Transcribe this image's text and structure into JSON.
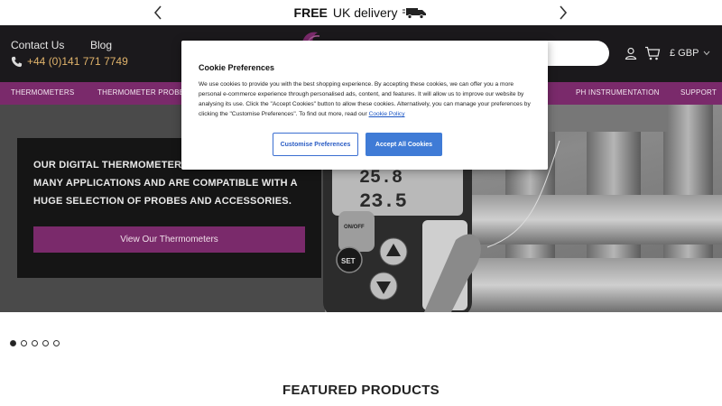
{
  "promo": {
    "bold": "FREE",
    "text": "UK delivery",
    "icon": "truck-icon"
  },
  "header": {
    "contact_label": "Contact Us",
    "blog_label": "Blog",
    "phone": "+44 (0)141 771 7749",
    "currency": "£ GBP",
    "colors": {
      "bg": "#1b191c",
      "accent": "#e0b36b"
    }
  },
  "nav": {
    "items": [
      "THERMOMETERS",
      "THERMOMETER PROBE",
      "PH INSTRUMENTATION",
      "SUPPORT"
    ],
    "color": "#7a2a6b"
  },
  "hero": {
    "headline": "OUR DIGITAL THERMOMETERS ARE SUITABLE FOR MANY APPLICATIONS AND ARE COMPATIBLE WITH A HUGE SELECTION OF PROBES AND ACCESSORIES.",
    "cta": "View Our Thermometers",
    "display_top": "25.8",
    "display_bottom": "23.5",
    "key_set": "SET",
    "key_on_off": "ON/OFF"
  },
  "carousel": {
    "slides": 5,
    "active": 1
  },
  "featured_title": "FEATURED PRODUCTS",
  "cookie": {
    "title": "Cookie Preferences",
    "body": "We use cookies to provide you with the best shopping experience. By accepting these cookies, we can offer you a more personal e-commerce experience through personalised ads, content, and features. It will allow us to improve our website by analysing its use. Click the \"Accept Cookies\" button to allow these cookies. Alternatively, you can manage your preferences by clicking the \"Customise Preferences\". To find out more, read our",
    "link": "Cookie Policy",
    "customise_label": "Customise Preferences",
    "accept_label": "Accept All Cookies",
    "colors": {
      "primary": "#3f7bd6"
    }
  }
}
